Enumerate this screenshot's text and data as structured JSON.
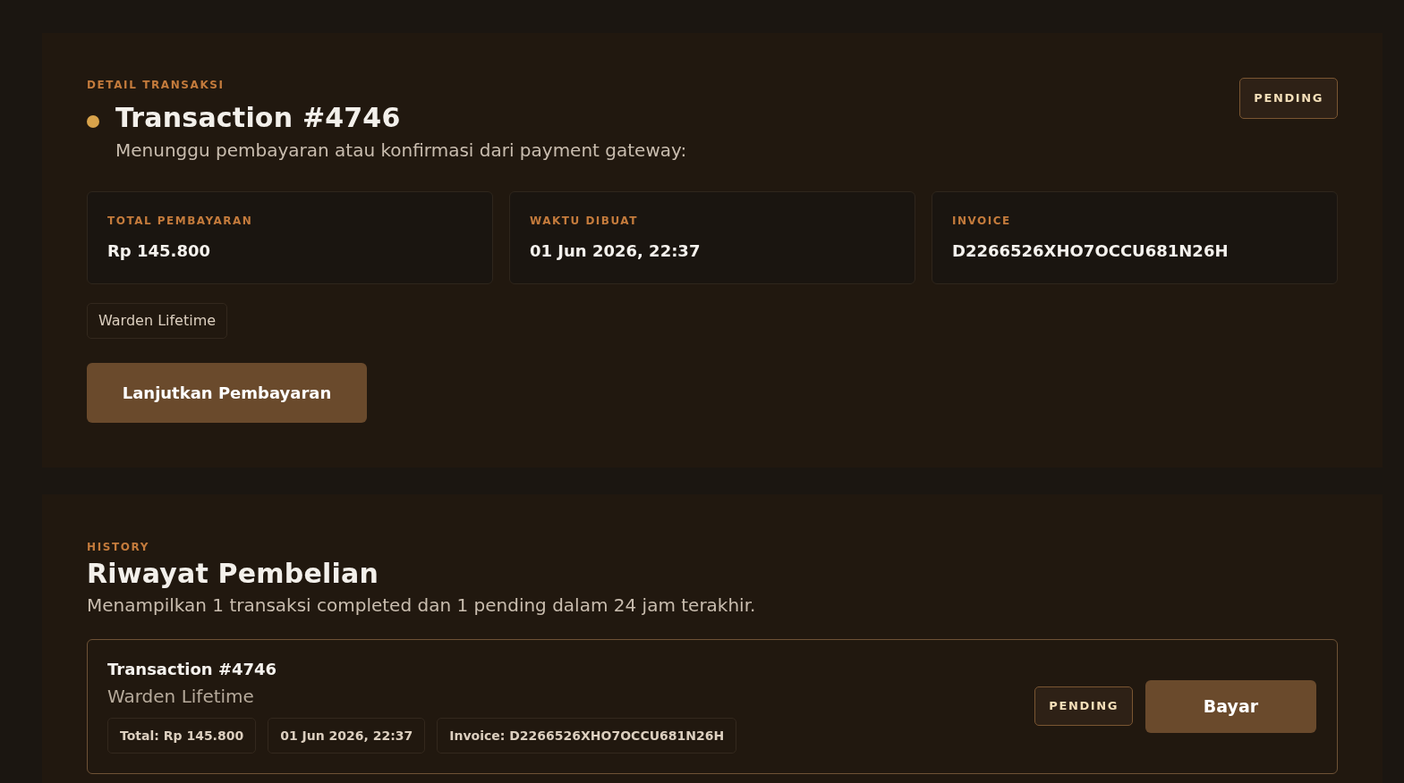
{
  "detail": {
    "eyebrow": "DETAIL TRANSAKSI",
    "status_dot": {
      "color": "#d9a34b"
    },
    "title": "Transaction #4746",
    "status_badge": "PENDING",
    "subtitle": "Menunggu pembayaran atau konfirmasi dari payment gateway:",
    "stats": [
      {
        "label": "TOTAL PEMBAYARAN",
        "value": "Rp 145.800"
      },
      {
        "label": "WAKTU DIBUAT",
        "value": "01 Jun 2026, 22:37"
      },
      {
        "label": "INVOICE",
        "value": "D2266526XHO7OCCU681N26H"
      }
    ],
    "product_tag": "Warden Lifetime",
    "action": "Lanjutkan Pembayaran"
  },
  "history": {
    "eyebrow": "HISTORY",
    "title": "Riwayat Pembelian",
    "subtitle": "Menampilkan 1 transaksi completed dan 1 pending dalam 24 jam terakhir.",
    "transactions": [
      {
        "title": "Transaction #4746",
        "product": "Warden Lifetime",
        "chips": [
          "Total: Rp 145.800",
          "01 Jun 2026, 22:37",
          "Invoice: D2266526XHO7OCCU681N26H"
        ],
        "status_badge": "PENDING",
        "action": "Bayar"
      }
    ]
  }
}
